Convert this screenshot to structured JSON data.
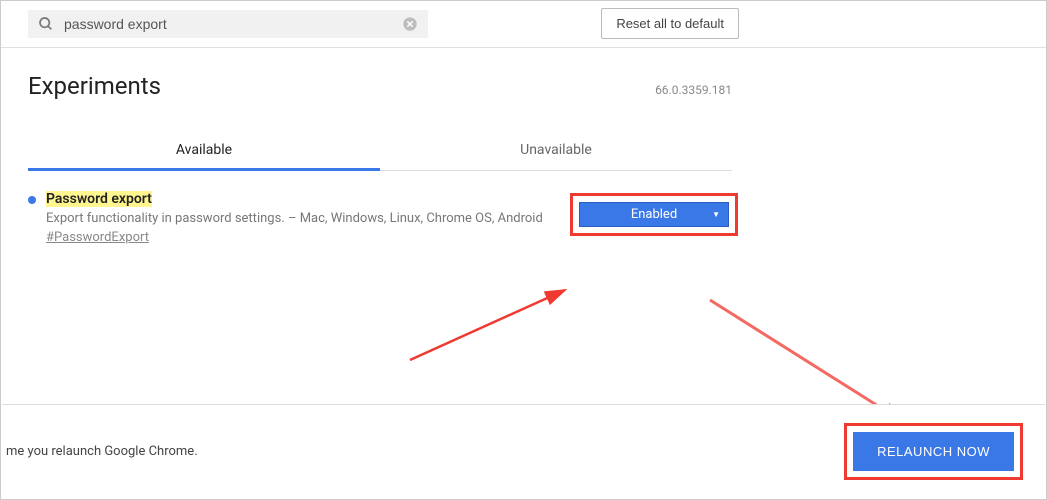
{
  "search": {
    "value": "password export"
  },
  "reset_button": "Reset all to default",
  "header": {
    "title": "Experiments",
    "version": "66.0.3359.181"
  },
  "tabs": {
    "available": "Available",
    "unavailable": "Unavailable"
  },
  "flag": {
    "title": "Password export",
    "description": "Export functionality in password settings. – Mac, Windows, Linux, Chrome OS, Android",
    "hash": "#PasswordExport",
    "status": "Enabled"
  },
  "bottom": {
    "text": "me you relaunch Google Chrome.",
    "relaunch": "RELAUNCH NOW"
  }
}
